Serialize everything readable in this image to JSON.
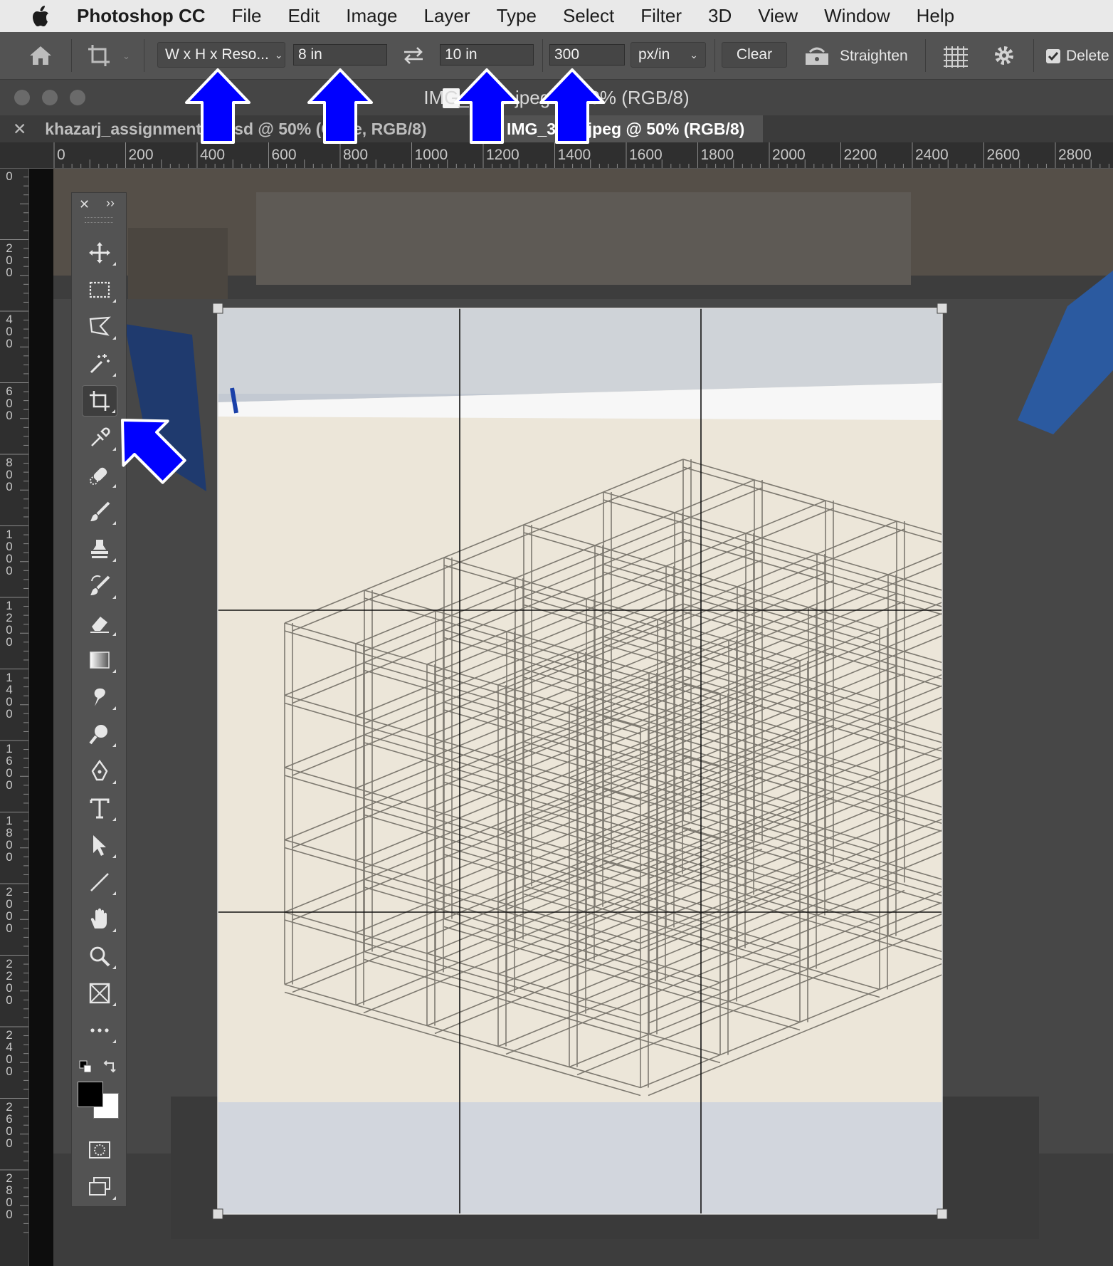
{
  "menubar": {
    "app_name": "Photoshop CC",
    "items": [
      "File",
      "Edit",
      "Image",
      "Layer",
      "Type",
      "Select",
      "Filter",
      "3D",
      "View",
      "Window",
      "Help"
    ]
  },
  "options_bar": {
    "ratio_preset": "W x H x Reso...",
    "width_value": "8 in",
    "height_value": "10 in",
    "resolution_value": "300",
    "resolution_unit": "px/in",
    "clear_label": "Clear",
    "straighten_label": "Straighten",
    "delete_label": "Delete",
    "delete_checked": true
  },
  "document": {
    "title": "IMG_3555.jpeg @ 50% (RGB/8)",
    "tabs": [
      {
        "label": "khazarj_assignment02.psd @ 50% (Cube, RGB/8)",
        "active": false
      },
      {
        "label": "IMG_3555.jpeg @ 50% (RGB/8)",
        "active": true
      }
    ]
  },
  "rulers": {
    "horizontal": [
      "0",
      "200",
      "400",
      "600",
      "800",
      "1000",
      "1200",
      "1400",
      "1600",
      "1800",
      "2000",
      "2200",
      "2400",
      "2600",
      "2800"
    ],
    "vertical": [
      "0",
      "200",
      "400",
      "600",
      "800",
      "1000",
      "1200",
      "1400",
      "1600",
      "1800",
      "2000",
      "2200",
      "2400",
      "2600",
      "2800"
    ]
  },
  "tools": [
    {
      "name": "move-tool-icon"
    },
    {
      "name": "rectangular-marquee-tool-icon"
    },
    {
      "name": "polygonal-lasso-tool-icon"
    },
    {
      "name": "magic-wand-tool-icon"
    },
    {
      "name": "crop-tool-icon",
      "selected": true
    },
    {
      "name": "eyedropper-tool-icon"
    },
    {
      "name": "spot-healing-brush-tool-icon"
    },
    {
      "name": "brush-tool-icon"
    },
    {
      "name": "clone-stamp-tool-icon"
    },
    {
      "name": "history-brush-tool-icon"
    },
    {
      "name": "eraser-tool-icon"
    },
    {
      "name": "gradient-tool-icon"
    },
    {
      "name": "smudge-tool-icon"
    },
    {
      "name": "dodge-tool-icon"
    },
    {
      "name": "pen-tool-icon"
    },
    {
      "name": "type-tool-icon"
    },
    {
      "name": "path-selection-tool-icon"
    },
    {
      "name": "line-tool-icon"
    },
    {
      "name": "hand-tool-icon"
    },
    {
      "name": "zoom-tool-icon"
    },
    {
      "name": "frame-tool-icon"
    },
    {
      "name": "more-tools-icon"
    }
  ],
  "colors": {
    "foreground": "#000000",
    "background": "#ffffff",
    "annotation_arrow": "#0000ff"
  }
}
